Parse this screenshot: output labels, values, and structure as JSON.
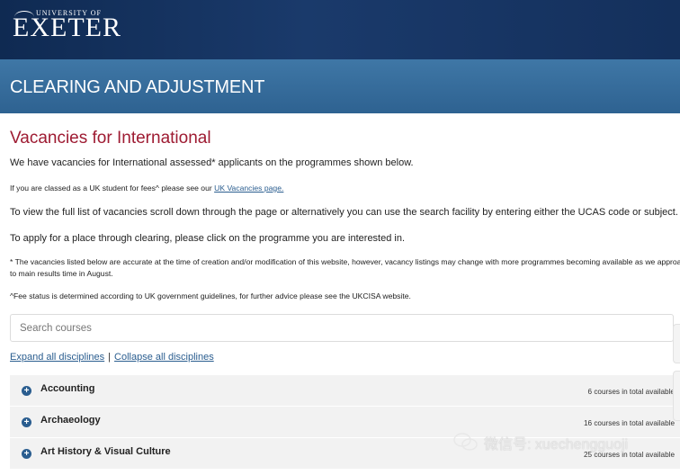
{
  "header": {
    "logo_small": "UNIVERSITY OF",
    "logo_big": "EXETER",
    "banner_title": "CLEARING AND ADJUSTMENT"
  },
  "main": {
    "title": "Vacancies for International",
    "intro": "We have vacancies for International assessed* applicants on the programmes shown below.",
    "uk_note_prefix": "If you are classed as a UK student for fees^ please see our ",
    "uk_note_link": "UK Vacancies page.",
    "view_text": "To view the full list of vacancies scroll down through the page or alternatively you can use the search facility by entering either the UCAS code or subject.",
    "apply_text": "To apply for a place through clearing, please click on the programme you are interested in.",
    "disclaimer_line1": "* The vacancies listed below are accurate at the time of creation and/or modification of this website, however, vacancy listings may change with more programmes becoming available as we approach",
    "disclaimer_line2": "to main results time in August.",
    "fee_note": "^Fee status is determined according to UK government guidelines, for further advice please see the UKCISA website."
  },
  "search": {
    "placeholder": "Search courses"
  },
  "controls": {
    "expand_all": "Expand all disciplines",
    "separator": "|",
    "collapse_all": "Collapse all disciplines"
  },
  "disciplines": [
    {
      "name": "Accounting",
      "count": "6 courses in total available"
    },
    {
      "name": "Archaeology",
      "count": "16 courses in total available"
    },
    {
      "name": "Art History & Visual Culture",
      "count": "25 courses in total available"
    }
  ],
  "watermark": {
    "text": "微信号: xuechengguoji"
  },
  "colors": {
    "header_bg": "#14305c",
    "banner_bg": "#3a6f9e",
    "title_red": "#9e1b32",
    "link_blue": "#2a5d8f",
    "accordion_bg": "#f2f2f2"
  }
}
